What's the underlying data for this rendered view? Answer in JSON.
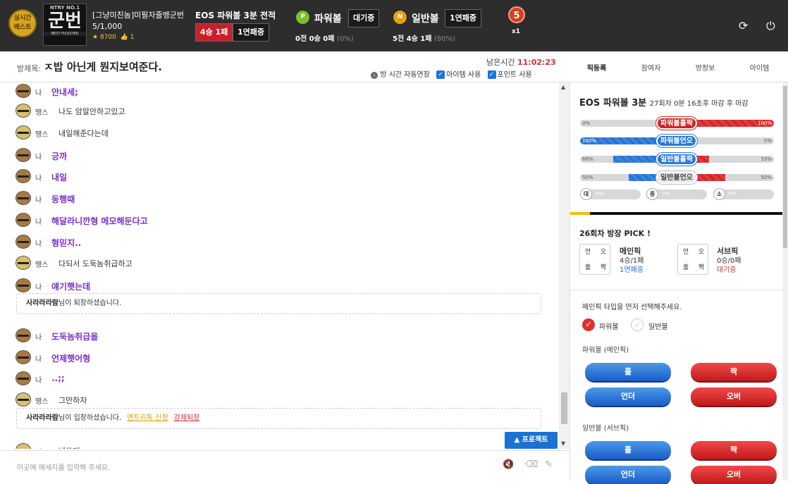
{
  "header": {
    "badge": "실시간 베스트",
    "rank_card": {
      "top": "NTRY NO.1",
      "main": "군번",
      "bottom": "BEST PICKSTER"
    },
    "user_name": "[그냥미친놈]미필자줄뱅군번",
    "user_count": "5/1,000",
    "user_points": "8700",
    "user_likes": "1",
    "game_title": "EOS 파워볼 3분 전적",
    "main_record": "4승 1패",
    "main_status": "1연패중",
    "powerball": {
      "coin": "P",
      "label": "파워볼",
      "status": "대기중",
      "record": "0전 0승 0패",
      "rate": "(0%)"
    },
    "normalball": {
      "coin": "N",
      "label": "일반볼",
      "status": "1연패중",
      "record": "5전 4승 1패",
      "rate": "(80%)"
    },
    "medal": "5",
    "medal_mult": "x1"
  },
  "room": {
    "label": "방제목:",
    "title": "ㅈ밥 아닌게 뭔지보여준다.",
    "remain_label": "남은시간",
    "remain_time": "11:02:23",
    "auto_ext": "방 시간 자동연장",
    "item_use": "아이템 사용",
    "point_use": "포인트 사용"
  },
  "tabs": [
    "픽등록",
    "참여자",
    "방정보",
    "아이템"
  ],
  "chat": [
    {
      "type": "msg",
      "me": true,
      "name": "나",
      "text": "안내세;"
    },
    {
      "type": "msg",
      "me": false,
      "name": "땡스",
      "text": "나도 암말안하고있고"
    },
    {
      "type": "msg",
      "me": false,
      "name": "땡스",
      "text": "내일해준다는데"
    },
    {
      "type": "msg",
      "me": true,
      "name": "나",
      "text": "긍까"
    },
    {
      "type": "msg",
      "me": true,
      "name": "나",
      "text": "내일"
    },
    {
      "type": "msg",
      "me": true,
      "name": "나",
      "text": "동행때"
    },
    {
      "type": "msg",
      "me": true,
      "name": "나",
      "text": "해달라니깐형 메모해둔다고"
    },
    {
      "type": "msg",
      "me": true,
      "name": "나",
      "text": "형믿지.."
    },
    {
      "type": "msg",
      "me": false,
      "name": "땡스",
      "text": "다되서 도둑놈취급하고"
    },
    {
      "type": "msg",
      "me": true,
      "name": "나",
      "text": "얘기햇는데"
    },
    {
      "type": "notice",
      "user": "사라라라람",
      "text": "님이 퇴장하셨습니다."
    },
    {
      "type": "msg",
      "me": true,
      "name": "나",
      "text": "도둑놈취급을"
    },
    {
      "type": "msg",
      "me": true,
      "name": "나",
      "text": "언제햇어형"
    },
    {
      "type": "msg",
      "me": true,
      "name": "나",
      "text": "..;;"
    },
    {
      "type": "msg",
      "me": false,
      "name": "땡스",
      "text": "그만하자"
    },
    {
      "type": "notice",
      "user": "사라라라람",
      "text": "님이 입장하셨습니다.",
      "link1": "엔트리톡 신청",
      "link2": "강제퇴장"
    },
    {
      "type": "msg",
      "me": false,
      "name": "땡스",
      "text": "낼쏠께"
    }
  ],
  "protect_btn": "▲ 프로젝트",
  "input_placeholder": "이곳에 메세지를 입력해 주세요.",
  "stats": {
    "title": "EOS 파워볼 3분",
    "sub": "27회차 0분 16초후 마감 후 마감",
    "rows": [
      {
        "label": "파워볼홀짝",
        "left": "0%",
        "right": "100%",
        "lv": 0,
        "rv": 100,
        "pill": "r"
      },
      {
        "label": "파워볼언오",
        "left": "100%",
        "right": "0%",
        "lv": 100,
        "rv": 0,
        "pill": "b"
      },
      {
        "label": "일반볼홀짝",
        "left": "66%",
        "right": "33%",
        "lv": 66,
        "rv": 33,
        "pill": "b"
      },
      {
        "label": "일반볼언오",
        "left": "50%",
        "right": "50%",
        "lv": 50,
        "rv": 50,
        "pill": "g"
      }
    ],
    "size": [
      {
        "l": "대",
        "v": "0%"
      },
      {
        "l": "중",
        "v": "0%"
      },
      {
        "l": "소",
        "v": "0%"
      }
    ]
  },
  "pick": {
    "title": "26회차 방장 PICK !",
    "main": {
      "grid": [
        "언",
        "오",
        "홀",
        "짝"
      ],
      "name": "메인픽",
      "rec": "4승/1패",
      "streak": "1연패중"
    },
    "sub": {
      "grid": [
        "언",
        "오",
        "홀",
        "짝"
      ],
      "name": "서브픽",
      "rec": "0승/0패",
      "streak": "대기중"
    }
  },
  "select": {
    "guide": "메인픽 타입을 먼저 선택해주세요.",
    "opt_power": "파워볼",
    "opt_normal": "일반볼",
    "power_label": "파워볼 (메인픽)",
    "normal_label": "일반볼 (서브픽)",
    "btn_odd": "홀",
    "btn_even": "짝",
    "btn_under": "언더",
    "btn_over": "오버"
  },
  "colors": {
    "accent_red": "#c8202a",
    "accent_blue": "#1a73d0",
    "me_text": "#7a30c8"
  }
}
